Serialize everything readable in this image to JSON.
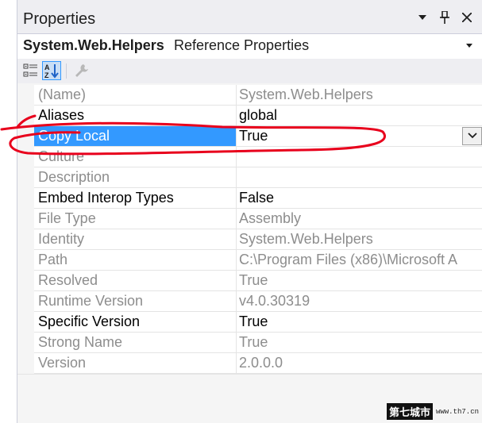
{
  "window": {
    "title": "Properties",
    "buttons": [
      {
        "icon": "dropdown-arrow-icon"
      },
      {
        "icon": "pin-icon"
      },
      {
        "icon": "close-icon"
      }
    ]
  },
  "object_selector": {
    "name": "System.Web.Helpers",
    "type": "Reference Properties"
  },
  "toolbar": {
    "buttons": [
      {
        "icon": "categorized-icon"
      },
      {
        "icon": "alphabetical-sort-icon",
        "active": true
      },
      {
        "icon": "property-pages-wrench-icon",
        "enabled": false
      }
    ]
  },
  "properties": [
    {
      "name": "(Name)",
      "value": "System.Web.Helpers",
      "readonly": true
    },
    {
      "name": "Aliases",
      "value": "global",
      "readonly": false
    },
    {
      "name": "Copy Local",
      "value": "True",
      "readonly": false,
      "selected": true
    },
    {
      "name": "Culture",
      "value": "",
      "readonly": true
    },
    {
      "name": "Description",
      "value": "",
      "readonly": true
    },
    {
      "name": "Embed Interop Types",
      "value": "False",
      "readonly": false
    },
    {
      "name": "File Type",
      "value": "Assembly",
      "readonly": true
    },
    {
      "name": "Identity",
      "value": "System.Web.Helpers",
      "readonly": true
    },
    {
      "name": "Path",
      "value": "C:\\Program Files (x86)\\Microsoft A",
      "readonly": true
    },
    {
      "name": "Resolved",
      "value": "True",
      "readonly": true
    },
    {
      "name": "Runtime Version",
      "value": "v4.0.30319",
      "readonly": true
    },
    {
      "name": "Specific Version",
      "value": "True",
      "readonly": false
    },
    {
      "name": "Strong Name",
      "value": "True",
      "readonly": true
    },
    {
      "name": "Version",
      "value": "2.0.0.0",
      "readonly": true
    }
  ],
  "colors": {
    "selection": "#3399ff",
    "annotation": "#e8001c",
    "readonly_text": "#8d8d8d"
  },
  "watermark": {
    "site_name": "第七城市",
    "url": "www.th7.cn"
  }
}
